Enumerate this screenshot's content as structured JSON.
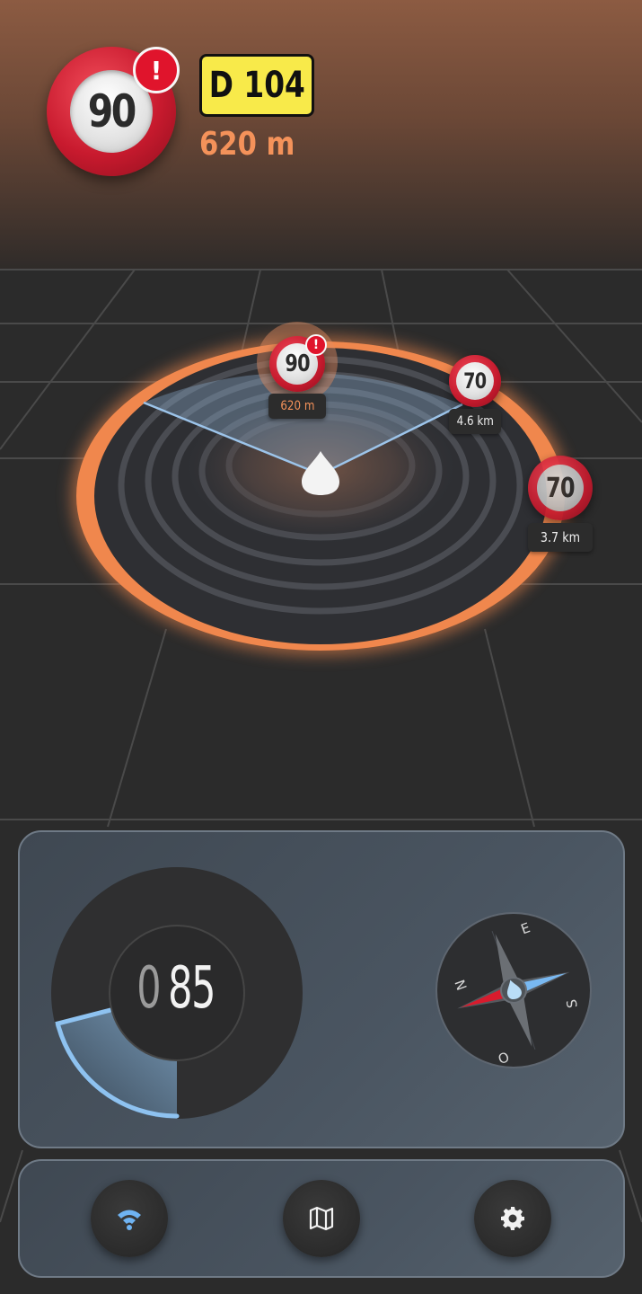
{
  "alert": {
    "speed_limit": "90",
    "warning_glyph": "!",
    "road": "D 104",
    "distance": "620 m"
  },
  "radar": {
    "markers": [
      {
        "limit": "90",
        "distance": "620 m",
        "warning": "!",
        "highlighted": true
      },
      {
        "limit": "70",
        "distance": "4.6 km",
        "warning": "",
        "highlighted": false
      },
      {
        "limit": "70",
        "distance": "3.7 km",
        "warning": "",
        "highlighted": false
      }
    ],
    "ring_color": "#f0874d"
  },
  "speedometer": {
    "leading_digit": "0",
    "speed": "85",
    "gauge_fraction": 0.35,
    "arc_color": "#8ec2f0"
  },
  "compass": {
    "north": "N",
    "east": "E",
    "south": "S",
    "west": "O",
    "needle_color_north": "#d81b2d",
    "needle_color_south": "#79b9f2"
  },
  "nav": {
    "buttons": [
      {
        "icon": "wifi-icon",
        "color": "#6fb3f2"
      },
      {
        "icon": "map-icon",
        "color": "#f2f2f2"
      },
      {
        "icon": "gear-icon",
        "color": "#f2f2f2"
      }
    ]
  }
}
